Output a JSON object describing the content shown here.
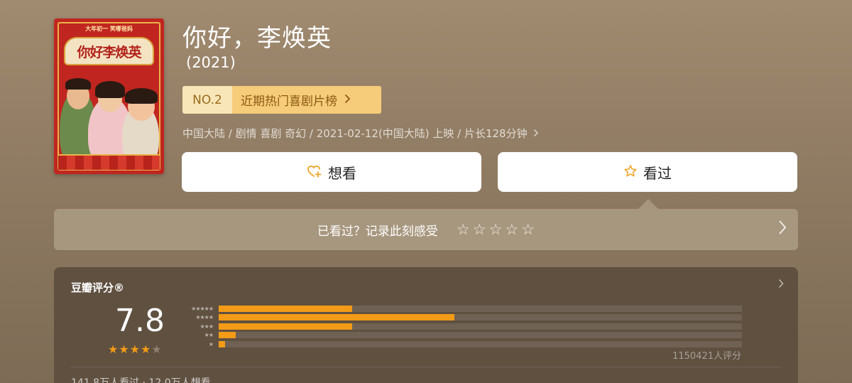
{
  "poster": {
    "tagline": "大年初一 笑哪爸妈",
    "banner_text": "你好李焕英"
  },
  "movie": {
    "title": "你好，李焕英",
    "year": "(2021)",
    "rank_no": "NO.2",
    "rank_label": "近期热门喜剧片榜",
    "meta": "中国大陆 / 剧情 喜剧 奇幻 / 2021-02-12(中国大陆) 上映 / 片长128分钟"
  },
  "actions": {
    "want_label": "想看",
    "seen_label": "看过",
    "want_icon": "heart-plus-icon",
    "seen_icon": "star-outline-icon"
  },
  "record": {
    "question": "已看过？记录此刻感受",
    "star_count": 5
  },
  "rating": {
    "heading": "豆瓣评分®",
    "score": "7.8",
    "stars_filled": 4,
    "stars_total": 5,
    "distribution": [
      {
        "stars": "★★★★★",
        "fraction": 0.255
      },
      {
        "stars": "★★★★",
        "fraction": 0.45
      },
      {
        "stars": "★★★",
        "fraction": 0.255
      },
      {
        "stars": "★★",
        "fraction": 0.032
      },
      {
        "stars": "★",
        "fraction": 0.012
      }
    ],
    "count_text": "1150421人评分",
    "watch_text": "141.8万人看过 · 12.0万人想看"
  },
  "colors": {
    "accent": "#f39b16",
    "rank_bg": "#f6cc7a"
  }
}
